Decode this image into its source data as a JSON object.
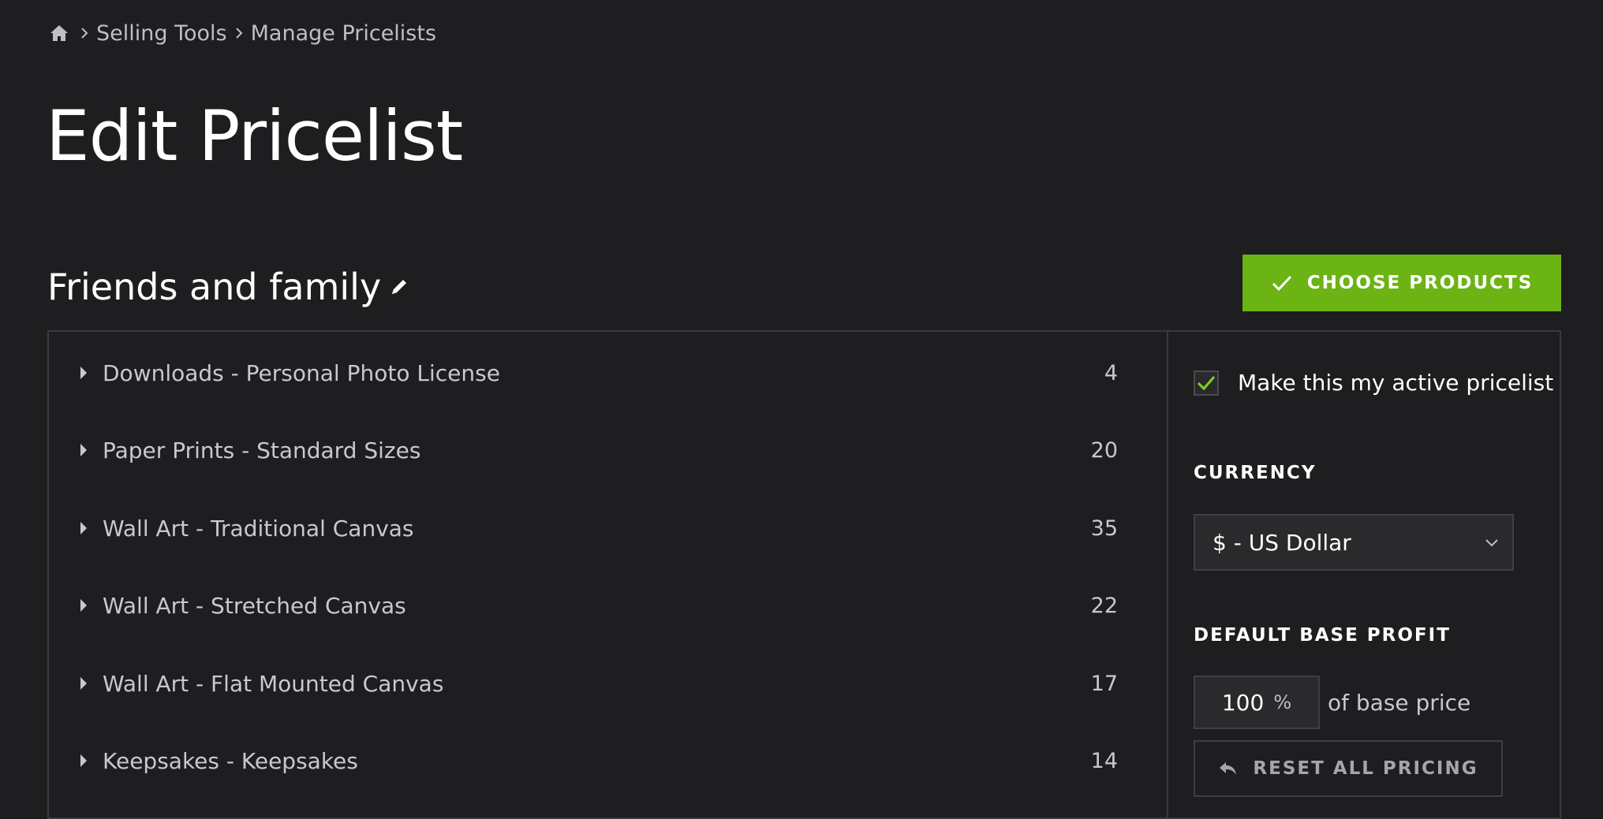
{
  "breadcrumb": {
    "home_icon": "home-icon",
    "items": [
      "Selling Tools",
      "Manage Pricelists"
    ]
  },
  "page": {
    "title": "Edit Pricelist"
  },
  "pricelist": {
    "name": "Friends and family",
    "edit_icon": "pencil-icon"
  },
  "actions": {
    "choose_products_label": "CHOOSE PRODUCTS",
    "choose_products_color": "#6cb314"
  },
  "products": [
    {
      "name": "Downloads - Personal Photo License",
      "count": "4"
    },
    {
      "name": "Paper Prints - Standard Sizes",
      "count": "20"
    },
    {
      "name": "Wall Art - Traditional Canvas",
      "count": "35"
    },
    {
      "name": "Wall Art - Stretched Canvas",
      "count": "22"
    },
    {
      "name": "Wall Art - Flat Mounted Canvas",
      "count": "17"
    },
    {
      "name": "Keepsakes - Keepsakes",
      "count": "14"
    }
  ],
  "sidebar": {
    "active_label": "Make this my active pricelist",
    "active_checked": true,
    "currency_label": "CURRENCY",
    "currency_value": "$ - US Dollar",
    "profit_label": "DEFAULT BASE PROFIT",
    "profit_value": "100",
    "profit_unit": "%",
    "profit_suffix": "of base price",
    "reset_label": "RESET ALL PRICING"
  },
  "colors": {
    "background": "#1e1e20",
    "accent_green": "#6cb314",
    "border": "#3a3a3e"
  }
}
